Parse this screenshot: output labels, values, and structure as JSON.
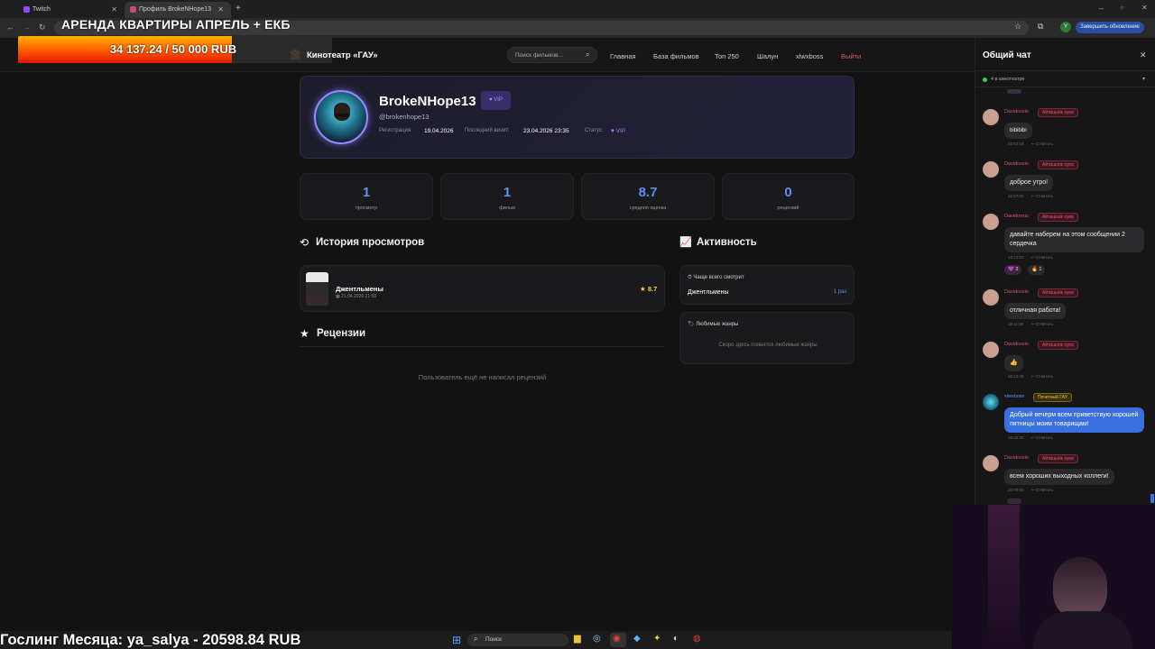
{
  "browser": {
    "tabs": [
      {
        "label": "Twitch"
      },
      {
        "label": "Профиль BrokeNHope13"
      }
    ],
    "new_tab": "+",
    "update_button": "Завершить обновление",
    "profile_initial": "Y"
  },
  "overlay": {
    "banner_title": "АРЕНДА КВАРТИРЫ АПРЕЛЬ + ЕКБ",
    "progress_text": "34 137.24 / 50 000 RUB",
    "progress_fraction": 0.68,
    "bottom_text": "Гослинг Месяца: ya_salya - 20598.84 RUB"
  },
  "site": {
    "logo": "Кинотеатр «ГАУ»",
    "search_placeholder": "Поиск фильмов...",
    "nav": [
      "Главная",
      "База фильмов",
      "Топ 250",
      "Шалун",
      "xlwxboss",
      "Выйти"
    ]
  },
  "profile": {
    "username": "BrokeNHope13",
    "badge": "VIP",
    "handle": "@brokenhope13",
    "reg_label": "Регистрация:",
    "reg_value": "19.04.2026",
    "visit_label": "Последний визит:",
    "visit_value": "23.04.2026 23:35",
    "status_label": "Статус:",
    "status_value": "VIP"
  },
  "stats": [
    {
      "value": "1",
      "label": "просмотр"
    },
    {
      "value": "1",
      "label": "фильм"
    },
    {
      "value": "8.7",
      "label": "средняя оценка"
    },
    {
      "value": "0",
      "label": "рецензий"
    }
  ],
  "history": {
    "title": "История просмотров",
    "items": [
      {
        "title": "Джентльмены",
        "date": "21.04.2026 21:59",
        "rating": "8.7"
      }
    ]
  },
  "activity": {
    "title": "Активность",
    "most_watched_label": "Чаще всего смотрит",
    "most_watched_title": "Джентльмены",
    "most_watched_count": "1 раз",
    "genres_label": "Любимые жанры",
    "genres_empty": "Скоро здесь появятся любимые жанры"
  },
  "reviews": {
    "title": "Рецензии",
    "empty": "Пользователь ещё не написал рецензий"
  },
  "chat": {
    "title": "Общий чат",
    "online": "4 в кинотеатре",
    "reply": "Ответить",
    "messages": [
      {
        "name": "Davidoxxio",
        "badge": "Айтишник хуев",
        "text": "bibibibi",
        "time": "02:52:18"
      },
      {
        "name": "Davidoxxio",
        "badge": "Айтишник хуев",
        "text": "доброе утро!",
        "time": "12:57:06"
      },
      {
        "name": "Davidoxxio",
        "badge": "Айтишник хуев",
        "text": "давайте наберем на этом сообщении 2 сердечка",
        "time": "13:12:03",
        "reactions": [
          "💜 3",
          "🔥 1"
        ]
      },
      {
        "name": "Davidoxxio",
        "badge": "Айтишник хуев",
        "text": "отличная работа!",
        "time": "16:11:06"
      },
      {
        "name": "Davidoxxio",
        "badge": "Айтишник хуев",
        "text": "👍",
        "time": "16:12:46"
      },
      {
        "name": "xlwxboss",
        "badge": "Почетный ГАУ",
        "text": "Добрый вечерм всем приветствую хорошей пятницы моим товарищам!",
        "time": "18:25:30"
      },
      {
        "name": "Davidoxxio",
        "badge": "Айтишник хуев",
        "text": "всем хороших выходных коллеги!",
        "time": "20:00:05"
      }
    ]
  },
  "taskbar": {
    "search": "Поиск"
  },
  "colors": {
    "accent": "#5f8ff0",
    "vip": "#8b6cf0",
    "danger": "#e0556f",
    "bg": "#121212"
  }
}
